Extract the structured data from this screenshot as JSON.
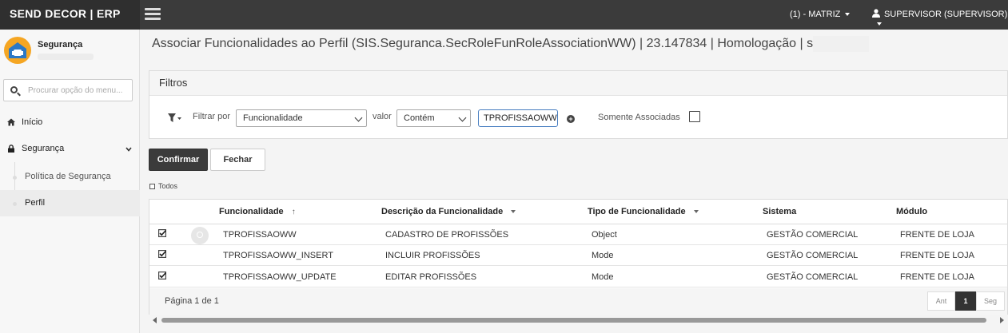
{
  "app": {
    "brand": "SEND DECOR | ERP"
  },
  "topbar": {
    "company": "(1) - MATRIZ",
    "user": "SUPERVISOR (SUPERVISOR)"
  },
  "sidebar": {
    "module_title": "Segurança",
    "search_placeholder": "Procurar opção do menu...",
    "items": [
      {
        "label": "Início",
        "icon": "home-icon"
      },
      {
        "label": "Segurança",
        "icon": "lock-icon"
      }
    ],
    "sub_items": [
      {
        "label": "Política de Segurança",
        "active": false
      },
      {
        "label": "Perfil",
        "active": true
      }
    ]
  },
  "page": {
    "title": "Associar Funcionalidades ao Perfil (SIS.Seguranca.SecRoleFunRoleAssociationWW) | 23.147834 | Homologação | s"
  },
  "filters": {
    "header": "Filtros",
    "filter_by_label": "Filtrar por",
    "filter_field": "Funcionalidade",
    "value_label": "valor",
    "operator": "Contém",
    "value": "TPROFISSAOWW",
    "only_associated_label": "Somente Associadas"
  },
  "actions": {
    "confirm": "Confirmar",
    "close": "Fechar"
  },
  "todos_label": "Todos",
  "grid": {
    "columns": [
      "Funcionalidade",
      "Descrição da Funcionalidade",
      "Tipo de Funcionalidade",
      "Sistema",
      "Módulo"
    ],
    "sort_indicator": "↑",
    "rows": [
      {
        "checked": true,
        "funcionalidade": "TPROFISSAOWW",
        "descricao": "CADASTRO DE PROFISSÕES",
        "tipo": "Object",
        "sistema": "GESTÃO COMERCIAL",
        "modulo": "FRENTE DE LOJA"
      },
      {
        "checked": true,
        "funcionalidade": "TPROFISSAOWW_INSERT",
        "descricao": "INCLUIR PROFISSÕES",
        "tipo": "Mode",
        "sistema": "GESTÃO COMERCIAL",
        "modulo": "FRENTE DE LOJA"
      },
      {
        "checked": true,
        "funcionalidade": "TPROFISSAOWW_UPDATE",
        "descricao": "EDITAR PROFISSÕES",
        "tipo": "Mode",
        "sistema": "GESTÃO COMERCIAL",
        "modulo": "FRENTE DE LOJA"
      }
    ],
    "page_info": "Página 1 de 1",
    "pager": {
      "prev": "Ant",
      "current": "1",
      "next": "Seg"
    }
  },
  "colors": {
    "topbar": "#3b3b3b",
    "accent": "#3b3b3b",
    "logo_blue": "#2b78c6"
  }
}
